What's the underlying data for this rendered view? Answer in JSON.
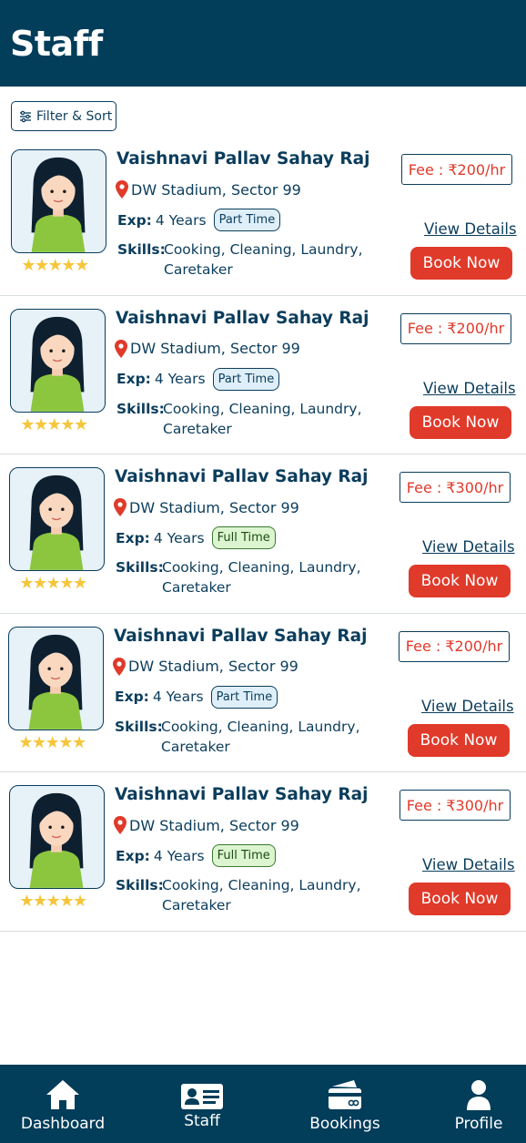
{
  "header": {
    "title": "Staff"
  },
  "toolbar": {
    "filter_label": "Filter & Sort"
  },
  "staff": [
    {
      "name": "Vaishnavi Pallav Sahay Raj",
      "location": "DW Stadium, Sector 99",
      "exp_label": "Exp:",
      "exp_value": "4 Years",
      "job_type": "Part Time",
      "skills_label": "Skills:",
      "skills": "Cooking, Cleaning, Laundry, Caretaker",
      "fee": "Fee : ₹200/hr",
      "rating": "★★★★★",
      "view_label": "View Details",
      "book_label": "Book Now"
    },
    {
      "name": "Vaishnavi Pallav Sahay Raj",
      "location": "DW Stadium, Sector 99",
      "exp_label": "Exp:",
      "exp_value": "4 Years",
      "job_type": "Part Time",
      "skills_label": "Skills:",
      "skills": "Cooking, Cleaning, Laundry, Caretaker",
      "fee": "Fee : ₹200/hr",
      "rating": "★★★★★",
      "view_label": "View Details",
      "book_label": "Book Now"
    },
    {
      "name": "Vaishnavi Pallav Sahay Raj",
      "location": "DW Stadium, Sector 99",
      "exp_label": "Exp:",
      "exp_value": "4 Years",
      "job_type": "Full Time",
      "skills_label": "Skills:",
      "skills": "Cooking, Cleaning, Laundry, Caretaker",
      "fee": "Fee : ₹300/hr",
      "rating": "★★★★★",
      "view_label": "View Details",
      "book_label": "Book Now"
    },
    {
      "name": "Vaishnavi Pallav Sahay Raj",
      "location": "DW Stadium, Sector 99",
      "exp_label": "Exp:",
      "exp_value": "4 Years",
      "job_type": "Part Time",
      "skills_label": "Skills:",
      "skills": "Cooking, Cleaning, Laundry, Caretaker",
      "fee": "Fee : ₹200/hr",
      "rating": "★★★★★",
      "view_label": "View Details",
      "book_label": "Book Now"
    },
    {
      "name": "Vaishnavi Pallav Sahay Raj",
      "location": "DW Stadium, Sector 99",
      "exp_label": "Exp:",
      "exp_value": "4 Years",
      "job_type": "Full Time",
      "skills_label": "Skills:",
      "skills": "Cooking, Cleaning, Laundry, Caretaker",
      "fee": "Fee : ₹300/hr",
      "rating": "★★★★★",
      "view_label": "View Details",
      "book_label": "Book Now"
    }
  ],
  "nav": [
    {
      "label": "Dashboard",
      "icon": "home-icon"
    },
    {
      "label": "Staff",
      "icon": "staff-card-icon"
    },
    {
      "label": "Bookings",
      "icon": "bookings-icon"
    },
    {
      "label": "Profile",
      "icon": "profile-icon"
    }
  ],
  "colors": {
    "primary": "#023d5a",
    "accent": "#e03a2a",
    "star": "#f5c63b"
  }
}
